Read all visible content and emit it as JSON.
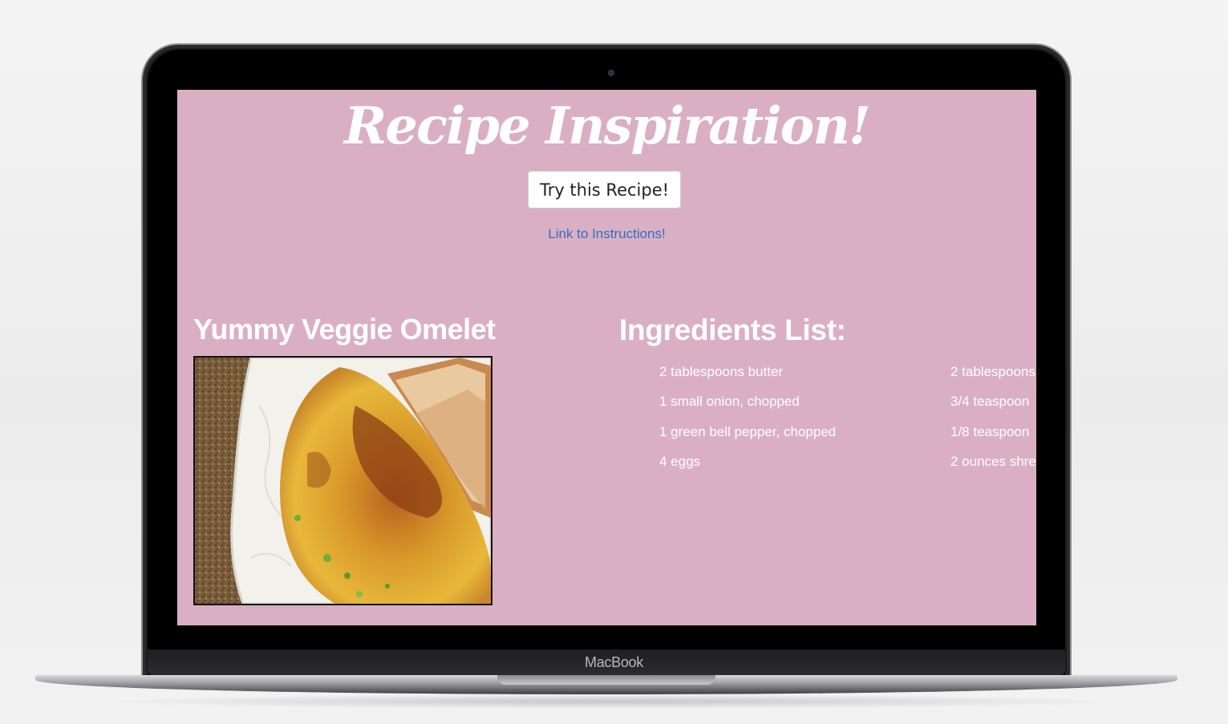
{
  "device": {
    "brand": "MacBook"
  },
  "page": {
    "title": "Recipe Inspiration!",
    "try_button": "Try this Recipe!",
    "instructions_link": "Link to Instructions!",
    "recipe_name": "Yummy Veggie Omelet",
    "ingredients_heading": "Ingredients List:",
    "ingredients_col1": [
      "2 tablespoons butter",
      "1 small onion, chopped",
      "1 green bell pepper, chopped",
      "4 eggs"
    ],
    "ingredients_col2": [
      "2 tablespoons",
      "3/4 teaspoon",
      "1/8 teaspoon",
      "2 ounces shre"
    ]
  },
  "colors": {
    "screen_background": "#dbafc3",
    "link": "#2e6fc4",
    "text": "#ffffff"
  }
}
